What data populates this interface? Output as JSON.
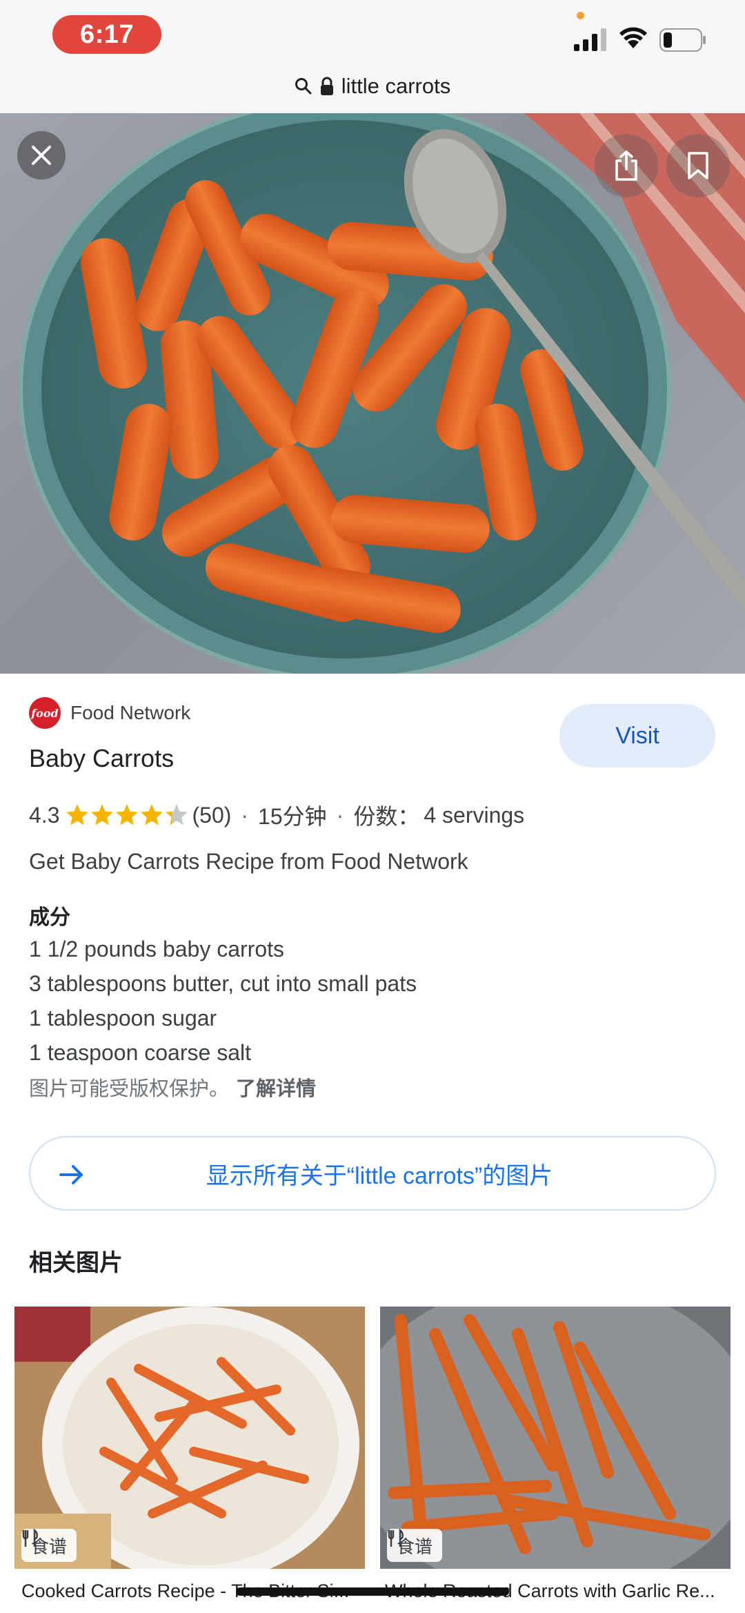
{
  "status_bar": {
    "time": "6:17",
    "icons": [
      "cellular-signal-icon",
      "wifi-icon",
      "battery-icon"
    ],
    "accent_color": "#e0463c"
  },
  "address_bar": {
    "url_text": "little carrots",
    "icons": [
      "search-icon",
      "lock-icon"
    ]
  },
  "hero": {
    "description_icons": [
      "close-icon",
      "share-icon",
      "bookmark-icon"
    ]
  },
  "result": {
    "source": "Food Network",
    "source_logo_text": "food",
    "visit_label": "Visit",
    "title": "Baby Carrots",
    "rating": "4.3",
    "rating_value": 4.3,
    "rating_max": 5,
    "review_count": "(50)",
    "time": "15分钟",
    "servings_label": "份数：",
    "servings": "4 servings",
    "description": "Get Baby Carrots Recipe from Food Network",
    "ingredients_heading": "成分",
    "ingredients": [
      "1 1/2 pounds baby carrots",
      "3 tablespoons butter, cut into small pats",
      "1 tablespoon sugar",
      "1 teaspoon coarse salt"
    ],
    "copyright": "图片可能受版权保护。",
    "learn_more": "了解详情"
  },
  "show_all": {
    "label": "显示所有关于“little carrots”的图片"
  },
  "related": {
    "heading": "相关图片",
    "items": [
      {
        "badge": "食谱",
        "caption": "Cooked Carrots Recipe - The Bitter Si..."
      },
      {
        "badge": "食谱",
        "caption": "Whole Roasted Carrots with Garlic Re..."
      }
    ]
  },
  "colors": {
    "link_blue": "#1a73e8",
    "visit_bg": "#e3ecf9",
    "star": "#f4b400"
  }
}
